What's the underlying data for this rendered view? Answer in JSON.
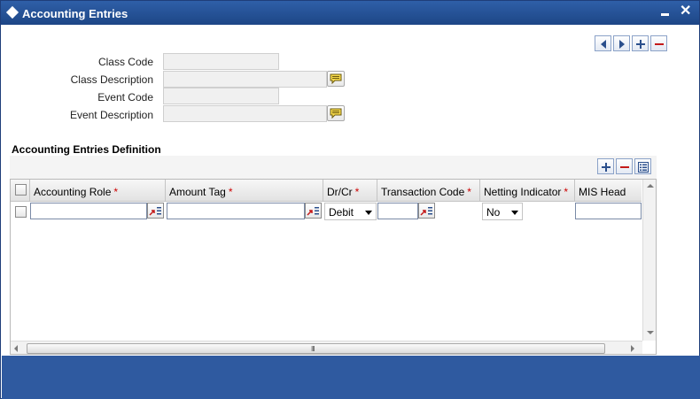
{
  "window": {
    "title": "Accounting Entries"
  },
  "form": {
    "class_code_label": "Class Code",
    "class_code_value": "",
    "class_description_label": "Class Description",
    "class_description_value": "",
    "event_code_label": "Event Code",
    "event_code_value": "",
    "event_description_label": "Event Description",
    "event_description_value": ""
  },
  "section": {
    "title": "Accounting Entries Definition"
  },
  "grid": {
    "columns": [
      {
        "label": "Accounting Role",
        "required": "*"
      },
      {
        "label": "Amount Tag",
        "required": "*"
      },
      {
        "label": "Dr/Cr",
        "required": "*"
      },
      {
        "label": "Transaction Code",
        "required": "*"
      },
      {
        "label": "Netting Indicator",
        "required": "*"
      },
      {
        "label": "MIS Head",
        "required": ""
      }
    ],
    "row": {
      "accounting_role": "",
      "amount_tag": "",
      "dr_cr": "Debit",
      "transaction_code": "",
      "netting_indicator": "No",
      "mis_head": ""
    },
    "scroll_grip": "III"
  },
  "colors": {
    "titlebar": "#1d4686",
    "footer": "#2f5aa0",
    "required": "#cc0000"
  }
}
